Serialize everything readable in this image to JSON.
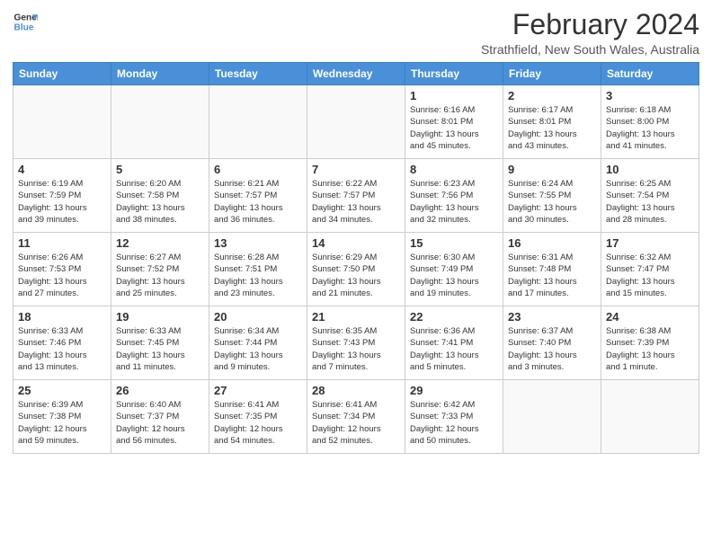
{
  "logo": {
    "line1": "General",
    "line2": "Blue"
  },
  "title": "February 2024",
  "subtitle": "Strathfield, New South Wales, Australia",
  "weekdays": [
    "Sunday",
    "Monday",
    "Tuesday",
    "Wednesday",
    "Thursday",
    "Friday",
    "Saturday"
  ],
  "weeks": [
    [
      {
        "day": "",
        "info": ""
      },
      {
        "day": "",
        "info": ""
      },
      {
        "day": "",
        "info": ""
      },
      {
        "day": "",
        "info": ""
      },
      {
        "day": "1",
        "info": "Sunrise: 6:16 AM\nSunset: 8:01 PM\nDaylight: 13 hours\nand 45 minutes."
      },
      {
        "day": "2",
        "info": "Sunrise: 6:17 AM\nSunset: 8:01 PM\nDaylight: 13 hours\nand 43 minutes."
      },
      {
        "day": "3",
        "info": "Sunrise: 6:18 AM\nSunset: 8:00 PM\nDaylight: 13 hours\nand 41 minutes."
      }
    ],
    [
      {
        "day": "4",
        "info": "Sunrise: 6:19 AM\nSunset: 7:59 PM\nDaylight: 13 hours\nand 39 minutes."
      },
      {
        "day": "5",
        "info": "Sunrise: 6:20 AM\nSunset: 7:58 PM\nDaylight: 13 hours\nand 38 minutes."
      },
      {
        "day": "6",
        "info": "Sunrise: 6:21 AM\nSunset: 7:57 PM\nDaylight: 13 hours\nand 36 minutes."
      },
      {
        "day": "7",
        "info": "Sunrise: 6:22 AM\nSunset: 7:57 PM\nDaylight: 13 hours\nand 34 minutes."
      },
      {
        "day": "8",
        "info": "Sunrise: 6:23 AM\nSunset: 7:56 PM\nDaylight: 13 hours\nand 32 minutes."
      },
      {
        "day": "9",
        "info": "Sunrise: 6:24 AM\nSunset: 7:55 PM\nDaylight: 13 hours\nand 30 minutes."
      },
      {
        "day": "10",
        "info": "Sunrise: 6:25 AM\nSunset: 7:54 PM\nDaylight: 13 hours\nand 28 minutes."
      }
    ],
    [
      {
        "day": "11",
        "info": "Sunrise: 6:26 AM\nSunset: 7:53 PM\nDaylight: 13 hours\nand 27 minutes."
      },
      {
        "day": "12",
        "info": "Sunrise: 6:27 AM\nSunset: 7:52 PM\nDaylight: 13 hours\nand 25 minutes."
      },
      {
        "day": "13",
        "info": "Sunrise: 6:28 AM\nSunset: 7:51 PM\nDaylight: 13 hours\nand 23 minutes."
      },
      {
        "day": "14",
        "info": "Sunrise: 6:29 AM\nSunset: 7:50 PM\nDaylight: 13 hours\nand 21 minutes."
      },
      {
        "day": "15",
        "info": "Sunrise: 6:30 AM\nSunset: 7:49 PM\nDaylight: 13 hours\nand 19 minutes."
      },
      {
        "day": "16",
        "info": "Sunrise: 6:31 AM\nSunset: 7:48 PM\nDaylight: 13 hours\nand 17 minutes."
      },
      {
        "day": "17",
        "info": "Sunrise: 6:32 AM\nSunset: 7:47 PM\nDaylight: 13 hours\nand 15 minutes."
      }
    ],
    [
      {
        "day": "18",
        "info": "Sunrise: 6:33 AM\nSunset: 7:46 PM\nDaylight: 13 hours\nand 13 minutes."
      },
      {
        "day": "19",
        "info": "Sunrise: 6:33 AM\nSunset: 7:45 PM\nDaylight: 13 hours\nand 11 minutes."
      },
      {
        "day": "20",
        "info": "Sunrise: 6:34 AM\nSunset: 7:44 PM\nDaylight: 13 hours\nand 9 minutes."
      },
      {
        "day": "21",
        "info": "Sunrise: 6:35 AM\nSunset: 7:43 PM\nDaylight: 13 hours\nand 7 minutes."
      },
      {
        "day": "22",
        "info": "Sunrise: 6:36 AM\nSunset: 7:41 PM\nDaylight: 13 hours\nand 5 minutes."
      },
      {
        "day": "23",
        "info": "Sunrise: 6:37 AM\nSunset: 7:40 PM\nDaylight: 13 hours\nand 3 minutes."
      },
      {
        "day": "24",
        "info": "Sunrise: 6:38 AM\nSunset: 7:39 PM\nDaylight: 13 hours\nand 1 minute."
      }
    ],
    [
      {
        "day": "25",
        "info": "Sunrise: 6:39 AM\nSunset: 7:38 PM\nDaylight: 12 hours\nand 59 minutes."
      },
      {
        "day": "26",
        "info": "Sunrise: 6:40 AM\nSunset: 7:37 PM\nDaylight: 12 hours\nand 56 minutes."
      },
      {
        "day": "27",
        "info": "Sunrise: 6:41 AM\nSunset: 7:35 PM\nDaylight: 12 hours\nand 54 minutes."
      },
      {
        "day": "28",
        "info": "Sunrise: 6:41 AM\nSunset: 7:34 PM\nDaylight: 12 hours\nand 52 minutes."
      },
      {
        "day": "29",
        "info": "Sunrise: 6:42 AM\nSunset: 7:33 PM\nDaylight: 12 hours\nand 50 minutes."
      },
      {
        "day": "",
        "info": ""
      },
      {
        "day": "",
        "info": ""
      }
    ]
  ]
}
